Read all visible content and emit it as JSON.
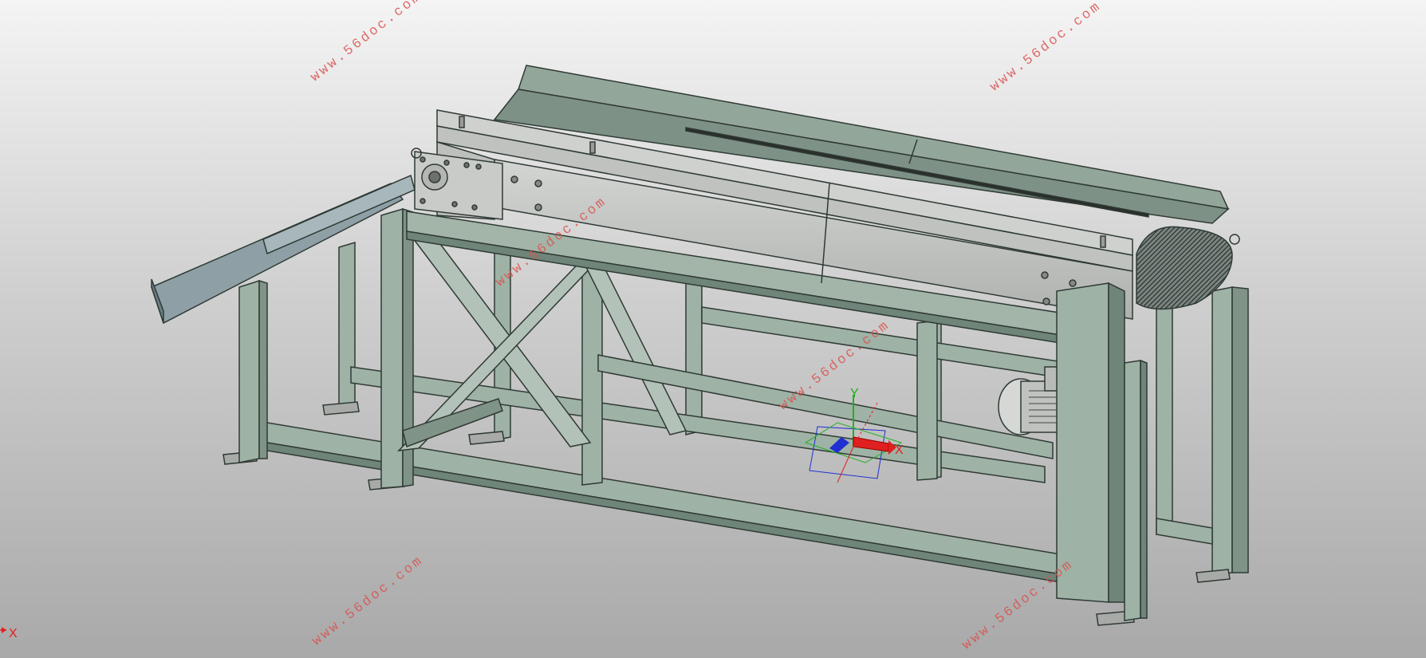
{
  "watermark": "www.56doc.com",
  "triad": {
    "x": "X",
    "y": "Y"
  },
  "corner_axis": {
    "x": "X"
  },
  "colors": {
    "frame": "#9fb2a6",
    "frame_dark": "#6f8579",
    "frame_edge": "#2f3a34",
    "deck": "#c4c6c4",
    "cover": "#8fa297",
    "roller": "#7d8a83",
    "watermark": "#d9534f",
    "axis_x": "#e02020",
    "axis_y": "#20b020",
    "axis_z": "#2030d0"
  },
  "icons": [
    "roller-brush-icon",
    "motor-icon",
    "drive-gear-icon"
  ]
}
